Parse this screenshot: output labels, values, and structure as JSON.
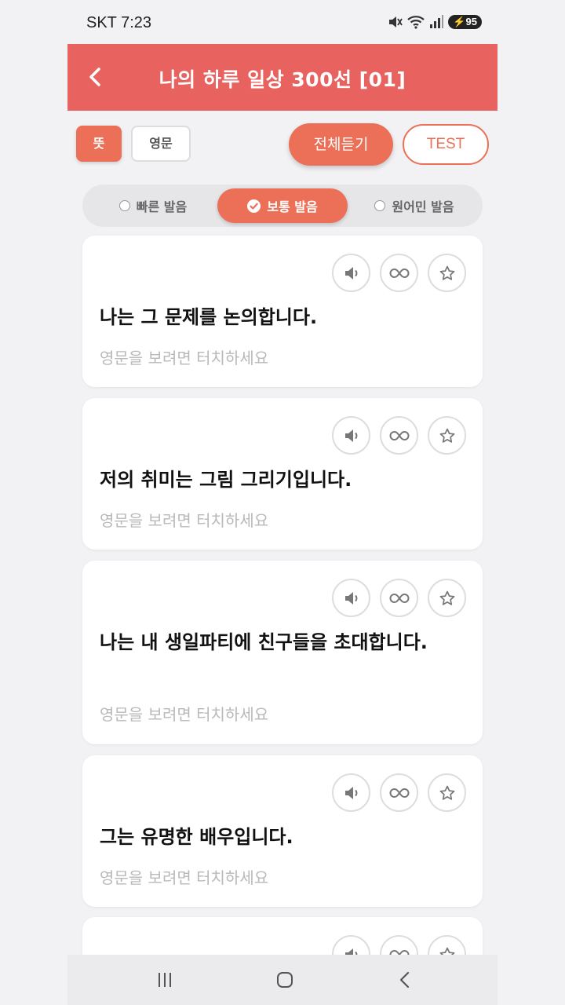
{
  "status_bar": {
    "carrier_time": "SKT 7:23",
    "battery": "95"
  },
  "header": {
    "title": "나의 하루 일상 300선 [01]",
    "back_icon": "chevron-left-icon"
  },
  "controls": {
    "meaning_label": "뜻",
    "english_label": "영문",
    "listen_all_label": "전체듣기",
    "test_label": "TEST"
  },
  "speed": {
    "options": [
      "빠른 발음",
      "보통 발음",
      "원어민 발음"
    ],
    "selected": "보통 발음"
  },
  "cards": [
    {
      "sentence": "나는 그 문제를 논의합니다.",
      "hint": "영문을 보려면 터치하세요"
    },
    {
      "sentence": "저의 취미는 그림 그리기입니다.",
      "hint": "영문을 보려면 터치하세요"
    },
    {
      "sentence": "나는 내 생일파티에 친구들을 초대합니다.",
      "hint": "영문을 보려면 터치하세요"
    },
    {
      "sentence": "그는 유명한 배우입니다.",
      "hint": "영문을 보려면 터치하세요"
    }
  ],
  "colors": {
    "accent": "#e8635f",
    "button": "#ec6f58",
    "background": "#f2f1f3"
  }
}
